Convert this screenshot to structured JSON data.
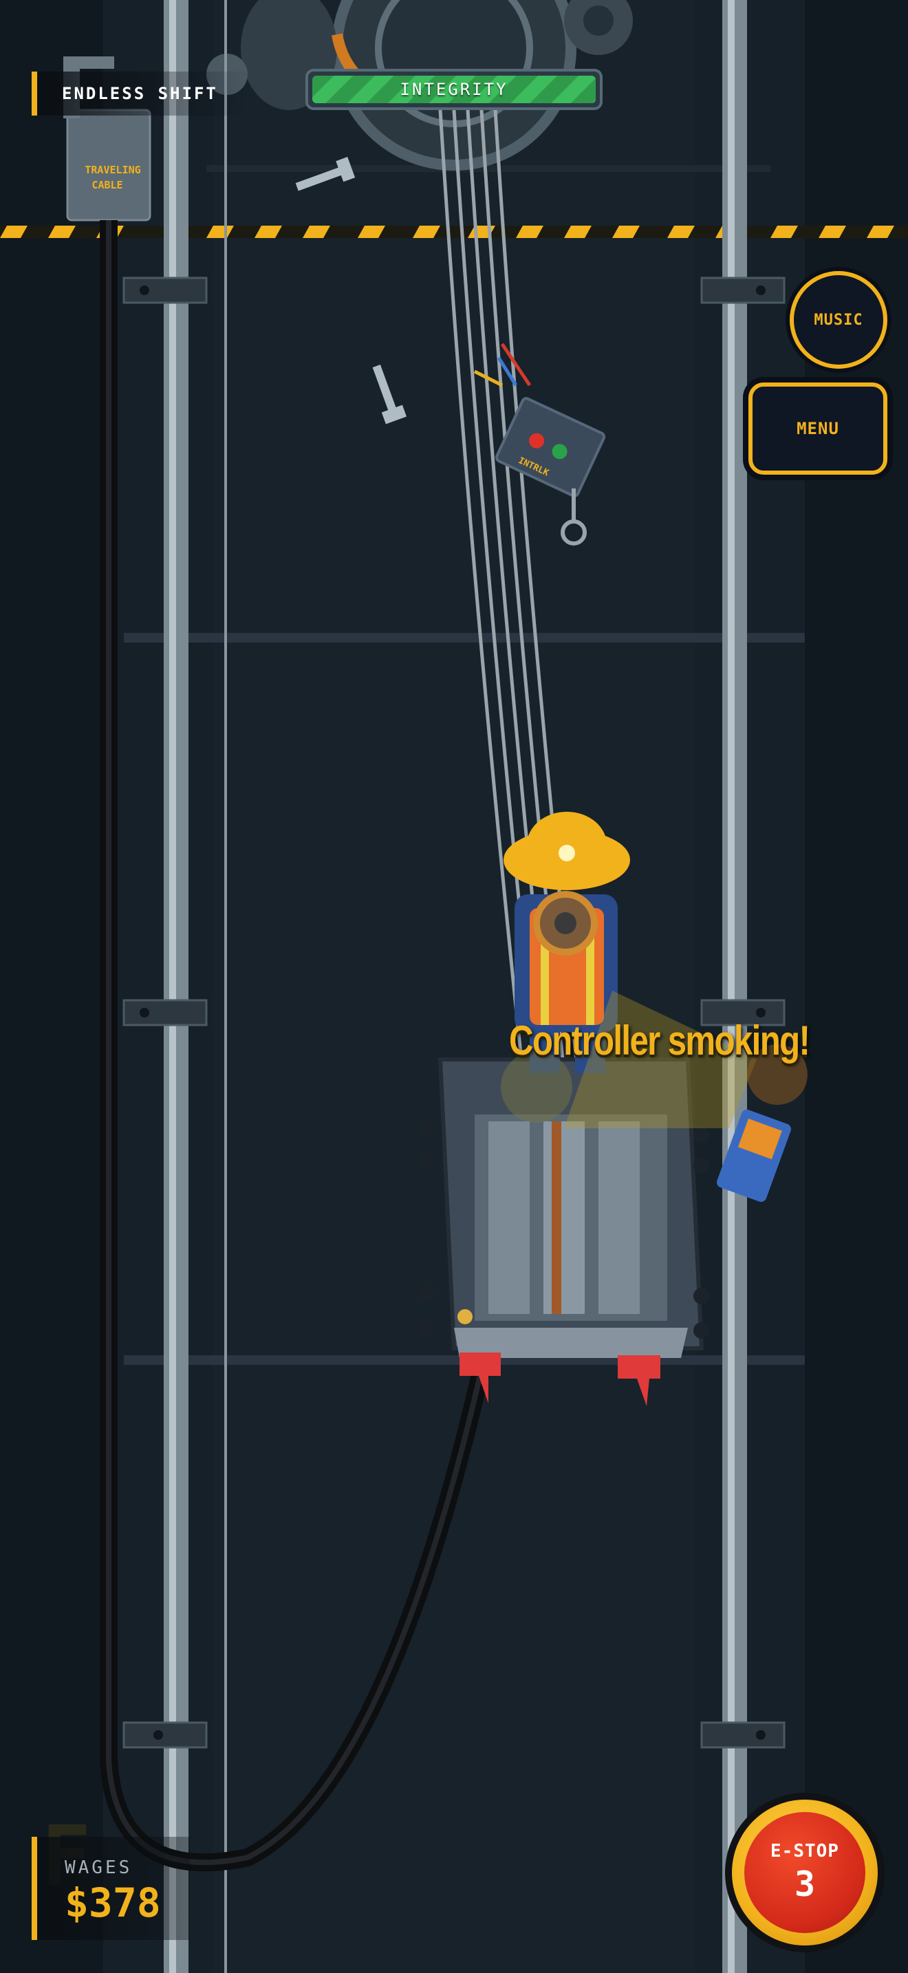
{
  "hud": {
    "mode_title": "ENDLESS SHIFT",
    "integrity_label": "INTEGRITY",
    "integrity_fraction": 1.0
  },
  "buttons": {
    "music_label": "MUSIC",
    "menu_label": "MENU",
    "estop_label": "E-STOP",
    "estop_count": "3"
  },
  "wages": {
    "label": "WAGES",
    "value": "$378"
  },
  "event": {
    "message": "Controller smoking!"
  },
  "scene": {
    "cable_box_label_1": "TRAVELING",
    "cable_box_label_2": "CABLE",
    "interlock_label": "INTRLK"
  },
  "colors": {
    "accent": "#f2b21c",
    "integrity_green": "#3cbc5c",
    "estop_red": "#d42a1a",
    "background": "#151d24"
  }
}
